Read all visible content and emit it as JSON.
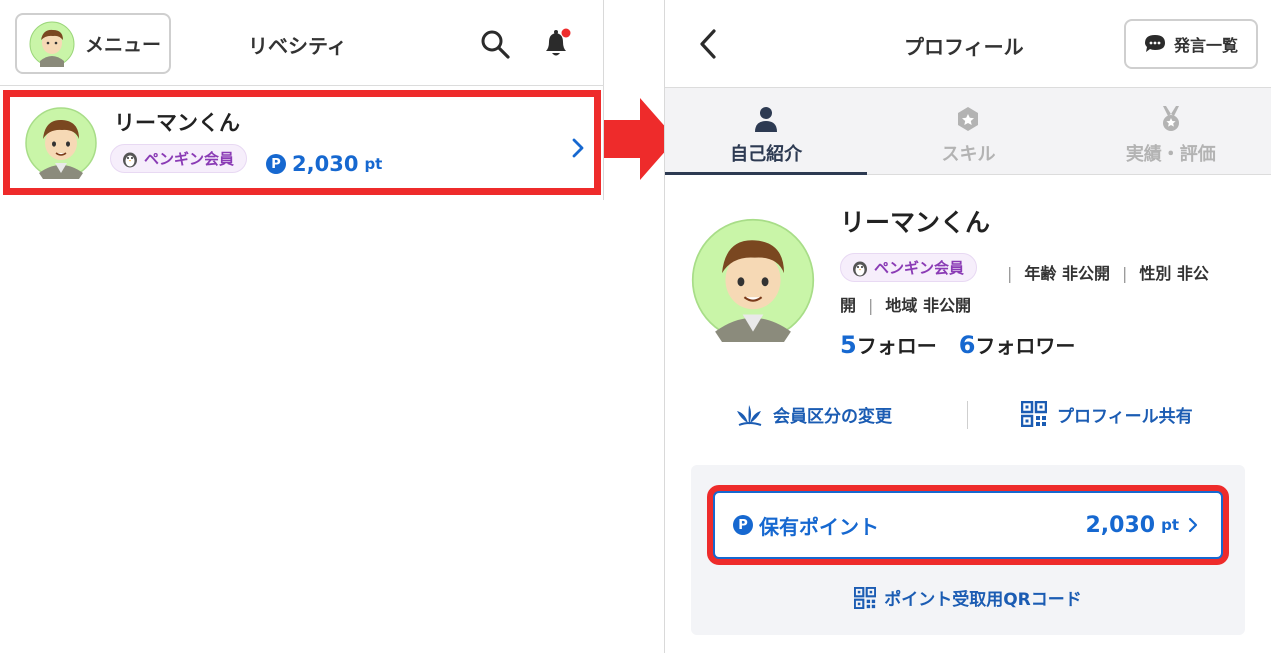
{
  "left": {
    "menu_label": "メニュー",
    "app_title": "リベシティ",
    "user": {
      "name": "リーマンくん",
      "badge": "ペンギン会員",
      "points": "2,030",
      "points_unit": "pt",
      "points_icon_letter": "P"
    }
  },
  "right": {
    "title": "プロフィール",
    "posts_button": "発言一覧",
    "tabs": [
      {
        "label": "自己紹介",
        "icon": "person-icon"
      },
      {
        "label": "スキル",
        "icon": "hexagon-star-icon"
      },
      {
        "label": "実績・評価",
        "icon": "medal-icon"
      }
    ],
    "profile": {
      "name": "リーマンくん",
      "badge": "ペンギン会員",
      "age": "年齢 非公開",
      "gender_part1": "性別 非公",
      "gender_part2": "開",
      "region": "地域 非公開",
      "follow_count": "5",
      "follow_label": "フォロー",
      "follower_count": "6",
      "follower_label": "フォロワー"
    },
    "actions": {
      "membership_change": "会員区分の変更",
      "profile_share": "プロフィール共有"
    },
    "points_card": {
      "label": "保有ポイント",
      "value": "2,030",
      "unit": "pt",
      "icon_letter": "P",
      "qr_link": "ポイント受取用QRコード"
    }
  },
  "colors": {
    "accent_blue": "#1668d0",
    "highlight_red": "#ee2b2b",
    "badge_purple": "#8a3bb5",
    "notification_dot": "#ee2b2b"
  }
}
